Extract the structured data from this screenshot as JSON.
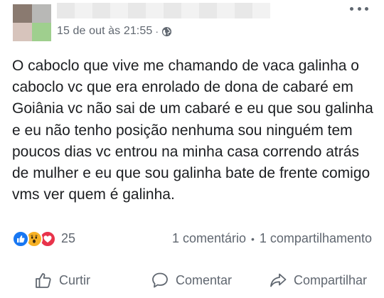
{
  "post": {
    "timestamp": "15 de out às 21:55",
    "separator": "·",
    "privacy_icon": "globe-icon",
    "text": "O caboclo que vive me chamando de vaca galinha o caboclo vc que era enrolado de dona de cabaré em Goiânia vc não sai de um cabaré e eu que sou galinha e eu não tenho posição nenhuma sou ninguém tem poucos dias vc entrou na minha casa correndo atrás de mulher e eu que sou galinha bate de frente comigo vms ver quem é galinha."
  },
  "reactions": {
    "icons": [
      "like-icon",
      "wow-icon",
      "love-icon"
    ],
    "count": "25",
    "comments": "1 comentário",
    "separator": "•",
    "shares": "1 compartilhamento"
  },
  "actions": {
    "like_label": "Curtir",
    "comment_label": "Comentar",
    "share_label": "Compartilhar"
  },
  "colors": {
    "text": "#1c1e21",
    "secondary": "#606770",
    "like_blue": "#1877f2",
    "wow_yellow": "#f7b125",
    "love_red": "#e8334a"
  }
}
